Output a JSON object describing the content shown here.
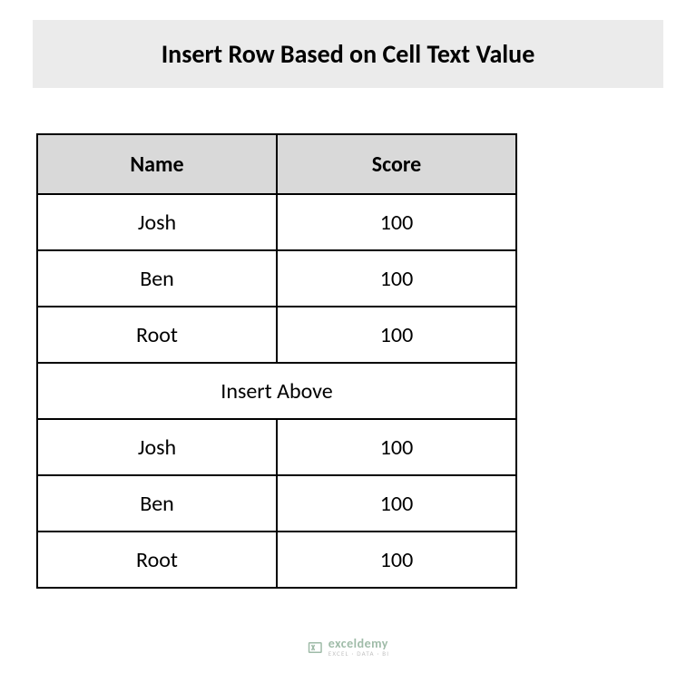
{
  "header": {
    "title": "Insert Row Based on Cell Text Value"
  },
  "table": {
    "columns": {
      "name": "Name",
      "score": "Score"
    },
    "rows": [
      {
        "name": "Josh",
        "score": "100"
      },
      {
        "name": "Ben",
        "score": "100"
      },
      {
        "name": "Root",
        "score": "100"
      }
    ],
    "merged_label": "Insert Above",
    "rows2": [
      {
        "name": "Josh",
        "score": "100"
      },
      {
        "name": "Ben",
        "score": "100"
      },
      {
        "name": "Root",
        "score": "100"
      }
    ]
  },
  "watermark": {
    "name": "exceldemy",
    "sub": "EXCEL · DATA · BI"
  }
}
